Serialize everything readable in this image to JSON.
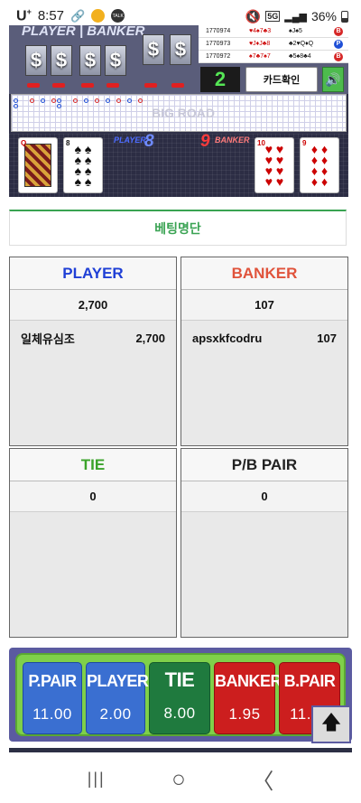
{
  "status_bar": {
    "carrier": "U",
    "carrier_sup": "+",
    "time": "8:57",
    "battery": "36%",
    "notif_talk": "TALK",
    "net": "5G"
  },
  "game": {
    "title_player": "PLAYER",
    "title_banker": "BANKER",
    "history": [
      {
        "id": "1770974",
        "player_cards": "♥4♠7♣3",
        "banker_cards": "♠J♠5",
        "result": "B",
        "result_color": "#d62828"
      },
      {
        "id": "1770973",
        "player_cards": "♥J♦J♣8",
        "banker_cards": "♣2♥Q♦Q",
        "result": "P",
        "result_color": "#1f4fd6"
      },
      {
        "id": "1770972",
        "player_cards": "♠7♣7♠7",
        "banker_cards": "♣5♠8♣4",
        "result": "B",
        "result_color": "#d62828"
      }
    ],
    "shoe_count": "2",
    "card_check_label": "카드확인",
    "big_road_label": "BIG ROAD",
    "player_label": "PLAYER",
    "player_value": "8",
    "banker_label": "BANKER",
    "banker_value": "9",
    "cards": [
      {
        "rank": "Q",
        "suit": "♥",
        "color": "#c00"
      },
      {
        "rank": "8",
        "suit": "♠",
        "color": "#111"
      },
      {
        "rank": "10",
        "suit": "♥",
        "color": "#c00"
      },
      {
        "rank": "9",
        "suit": "♦",
        "color": "#c00"
      }
    ]
  },
  "bet_list": {
    "title": "베팅명단"
  },
  "panels": {
    "player": {
      "title": "PLAYER",
      "color": "#1f3fd6",
      "total": "2,700",
      "rows": [
        {
          "name": "일체유심조",
          "amount": "2,700"
        }
      ]
    },
    "banker": {
      "title": "BANKER",
      "color": "#e0533b",
      "total": "107",
      "rows": [
        {
          "name": "apsxkfcodru",
          "amount": "107"
        }
      ]
    },
    "tie": {
      "title": "TIE",
      "color": "#3aa32a",
      "total": "0",
      "rows": []
    },
    "pair": {
      "title": "P/B PAIR",
      "color": "#222222",
      "total": "0",
      "rows": []
    }
  },
  "odds": [
    {
      "name": "P.PAIR",
      "value": "11.00"
    },
    {
      "name": "PLAYER",
      "value": "2.00"
    },
    {
      "name": "TIE",
      "value": "8.00"
    },
    {
      "name": "BANKER",
      "value": "1.95"
    },
    {
      "name": "B.PAIR",
      "value": "11.00"
    }
  ],
  "scroll_top_icon": "arrow-up-icon",
  "nav": {
    "recent": "|||",
    "home": "○",
    "back": "〈"
  }
}
